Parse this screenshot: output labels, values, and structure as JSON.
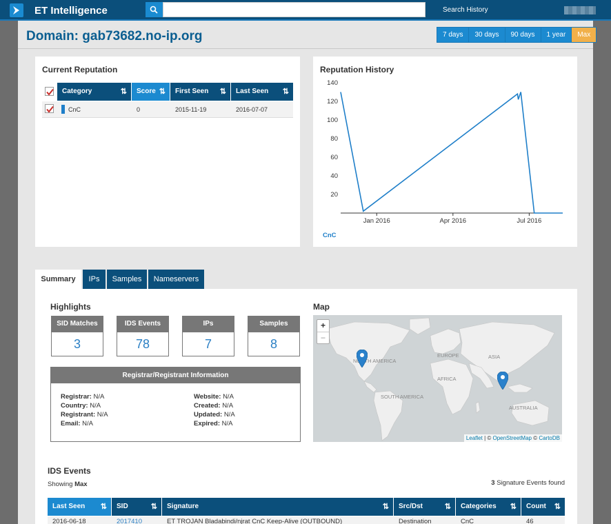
{
  "app": {
    "title": "ET Intelligence",
    "search_placeholder": "",
    "search_history": "Search History"
  },
  "domain": {
    "title": "Domain: gab73682.no-ip.org"
  },
  "ranges": [
    "7 days",
    "30 days",
    "90 days",
    "1 year",
    "Max"
  ],
  "active_range": "Max",
  "current_reputation": {
    "title": "Current Reputation",
    "columns": [
      "Category",
      "Score",
      "First Seen",
      "Last Seen"
    ],
    "rows": [
      {
        "category": "CnC",
        "score": "0",
        "first_seen": "2015-11-19",
        "last_seen": "2016-07-07",
        "color": "#1f7fc9"
      }
    ]
  },
  "reputation_history": {
    "title": "Reputation History",
    "legend": "CnC"
  },
  "chart_data": {
    "type": "line",
    "title": "Reputation History",
    "xlabel": "",
    "ylabel": "",
    "x_ticks": [
      "Jan 2016",
      "Apr 2016",
      "Jul 2016"
    ],
    "y_ticks": [
      20,
      40,
      60,
      80,
      100,
      120,
      140
    ],
    "ylim": [
      0,
      140
    ],
    "xlim": [
      "2015-11-19",
      "2016-08-10"
    ],
    "grid": false,
    "legend": "bottom-left",
    "series": [
      {
        "name": "CnC",
        "color": "#1f7fc9",
        "x": [
          "2015-11-19",
          "2015-12-16",
          "2016-06-17",
          "2016-06-18",
          "2016-06-21",
          "2016-07-07",
          "2016-08-10"
        ],
        "y": [
          130,
          2,
          128,
          122,
          130,
          0,
          0
        ]
      }
    ]
  },
  "tabs": [
    "Summary",
    "IPs",
    "Samples",
    "Nameservers"
  ],
  "active_tab": "Summary",
  "highlights": {
    "title": "Highlights",
    "items": [
      {
        "label": "SID Matches",
        "value": "3"
      },
      {
        "label": "IDS Events",
        "value": "78"
      },
      {
        "label": "IPs",
        "value": "7"
      },
      {
        "label": "Samples",
        "value": "8"
      }
    ]
  },
  "registrar": {
    "title": "Registrar/Registrant Information",
    "left": [
      {
        "label": "Registrar:",
        "value": "N/A"
      },
      {
        "label": "Country:",
        "value": "N/A"
      },
      {
        "label": "Registrant:",
        "value": "N/A"
      },
      {
        "label": "Email:",
        "value": "N/A"
      }
    ],
    "right": [
      {
        "label": "Website:",
        "value": "N/A"
      },
      {
        "label": "Created:",
        "value": "N/A"
      },
      {
        "label": "Updated:",
        "value": "N/A"
      },
      {
        "label": "Expired:",
        "value": "N/A"
      }
    ]
  },
  "map": {
    "title": "Map",
    "labels": [
      "NORTH AMERICA",
      "EUROPE",
      "ASIA",
      "AFRICA",
      "SOUTH AMERICA",
      "AUSTRALIA"
    ],
    "zoom_in": "+",
    "zoom_out": "−",
    "attribution": {
      "leaflet": "Leaflet",
      "sep1": " | © ",
      "osm": "OpenStreetMap",
      "sep2": " © ",
      "carto": "CartoDB"
    },
    "marker_color": "#2a81cb"
  },
  "ids_events": {
    "title": "IDS Events",
    "showing_label": "Showing",
    "showing_value": "Max",
    "found_count": "3",
    "found_label": "Signature Events found",
    "columns": [
      "Last Seen",
      "SID",
      "Signature",
      "Src/Dst",
      "Categories",
      "Count"
    ],
    "first_row": {
      "last_seen": "2016-06-18",
      "sid": "2017410",
      "signature": "ET TROJAN Bladabindi/njrat CnC Keep-Alive (OUTBOUND)",
      "src_dst": "Destination",
      "categories": "CnC",
      "count": "46"
    }
  }
}
